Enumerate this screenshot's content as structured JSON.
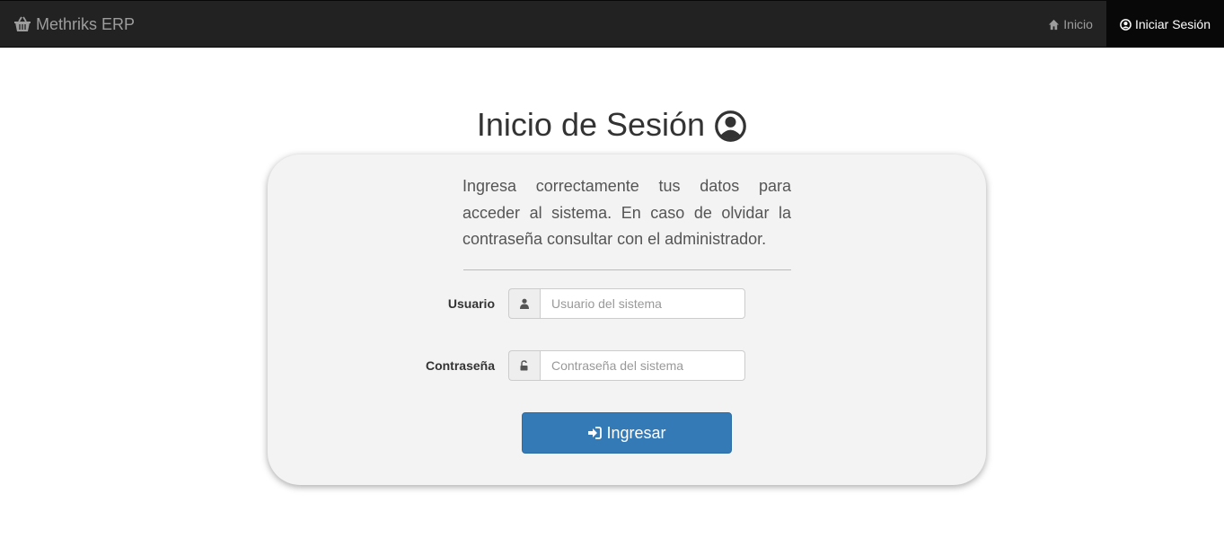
{
  "navbar": {
    "brand": "Methriks ERP",
    "brand_icon": "basket-icon",
    "links": [
      {
        "label": "Inicio",
        "icon": "home-icon",
        "active": false
      },
      {
        "label": "Iniciar Sesión",
        "icon": "user-circle-icon",
        "active": true
      }
    ]
  },
  "main": {
    "title": "Inicio de Sesión",
    "title_icon": "user-circle-icon",
    "intro": "Ingresa correctamente tus datos para acceder al sistema. En caso de olvidar la contraseña consultar con el administrador.",
    "form": {
      "user_label": "Usuario",
      "user_icon": "user-icon",
      "user_placeholder": "Usuario del sistema",
      "user_value": "",
      "password_label": "Contraseña",
      "password_icon": "unlock-icon",
      "password_placeholder": "Contraseña del sistema",
      "password_value": "",
      "submit_label": "Ingresar",
      "submit_icon": "sign-in-icon"
    }
  },
  "colors": {
    "navbar_bg": "#222222",
    "primary": "#337ab7",
    "card_bg": "#f3f3f3"
  }
}
